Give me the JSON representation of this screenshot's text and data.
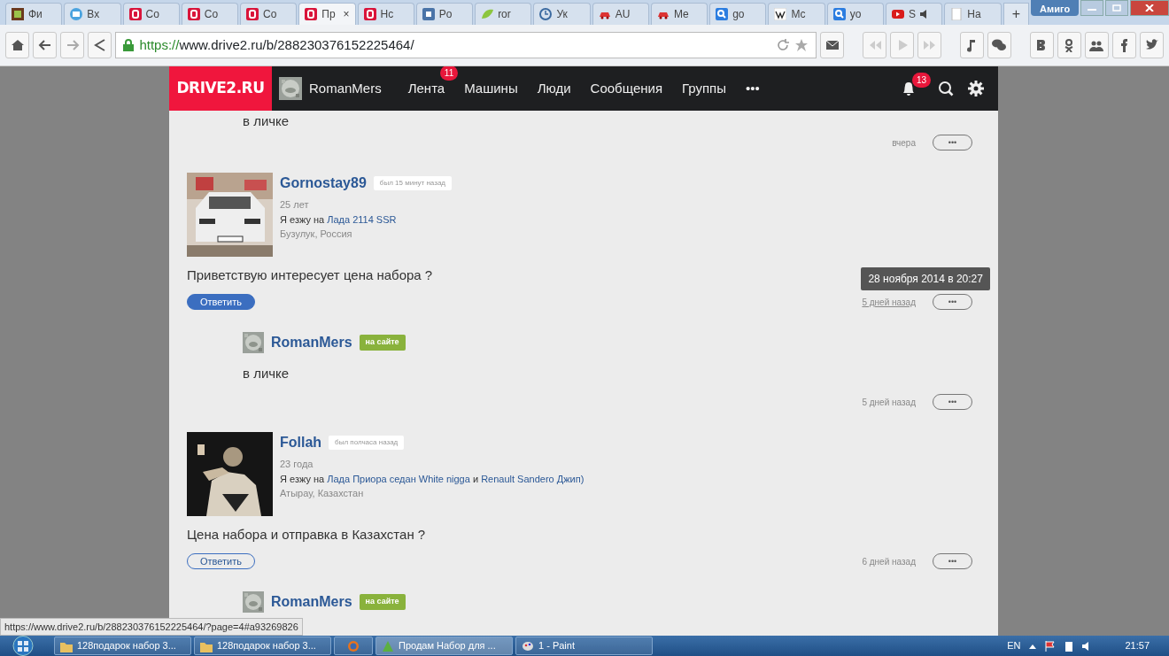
{
  "browser": {
    "tabs": [
      {
        "label": "Фи",
        "kind": "tile",
        "selected": false
      },
      {
        "label": "Вх",
        "kind": "mail",
        "selected": false
      },
      {
        "label": "Co",
        "kind": "drive",
        "selected": false
      },
      {
        "label": "Co",
        "kind": "drive",
        "selected": false
      },
      {
        "label": "Co",
        "kind": "drive",
        "selected": false
      },
      {
        "label": "Пр",
        "kind": "drive",
        "selected": true,
        "close": "×"
      },
      {
        "label": "Нс",
        "kind": "drive",
        "selected": false
      },
      {
        "label": "Po",
        "kind": "vk",
        "selected": false
      },
      {
        "label": "ror",
        "kind": "leaf",
        "selected": false
      },
      {
        "label": "Ук",
        "kind": "clock",
        "selected": false
      },
      {
        "label": "AU",
        "kind": "car",
        "selected": false
      },
      {
        "label": "Me",
        "kind": "car",
        "selected": false
      },
      {
        "label": "go",
        "kind": "search",
        "selected": false
      },
      {
        "label": "Mc",
        "kind": "wiki",
        "selected": false
      },
      {
        "label": "yo",
        "kind": "search",
        "selected": false
      },
      {
        "label": "S",
        "kind": "youtube",
        "selected": false,
        "muted": true
      },
      {
        "label": "На",
        "kind": "page",
        "selected": false
      }
    ],
    "new_tab": "+",
    "profile": "Амиго",
    "url_scheme": "https://",
    "url_rest": "www.drive2.ru/b/288230376152225464/",
    "status_url": "https://www.drive2.ru/b/288230376152225464/?page=4#a93269826"
  },
  "site": {
    "logo": "DRIVE2.RU",
    "user": "RomanMers",
    "nav": [
      {
        "label": "Лента",
        "badge": "11"
      },
      {
        "label": "Машины"
      },
      {
        "label": "Люди"
      },
      {
        "label": "Сообщения"
      },
      {
        "label": "Группы"
      },
      {
        "label": "•••"
      }
    ],
    "notifications": "13"
  },
  "comments": [
    {
      "kind": "tail",
      "text": "в личке",
      "time": "вчера",
      "more": "•••"
    },
    {
      "kind": "comment",
      "author": "Gornostay89",
      "status": {
        "text": "был 15 минут назад",
        "online": false
      },
      "age": "25 лет",
      "car": [
        {
          "kind": "text",
          "text": "Я езжу на"
        },
        {
          "kind": "link",
          "text": "Лада 2114 SSR"
        }
      ],
      "location": "Бузулук, Россия",
      "text": "Приветствую интересует цена набора ?",
      "reply": {
        "label": "Ответить",
        "selected": true
      },
      "time": "5 дней назад",
      "tooltip": "28 ноября 2014 в 20:27",
      "more": "•••"
    },
    {
      "kind": "reply",
      "author": "RomanMers",
      "status": {
        "text": "на сайте",
        "online": true
      },
      "text": "в личке",
      "time": "5 дней назад",
      "more": "•••"
    },
    {
      "kind": "comment",
      "author": "Follah",
      "status": {
        "text": "был полчаса назад",
        "online": false
      },
      "age": "23 года",
      "car": [
        {
          "kind": "text",
          "text": "Я езжу на"
        },
        {
          "kind": "link",
          "text": "Лада Приора седан White nigga"
        },
        {
          "kind": "text",
          "text": "и"
        },
        {
          "kind": "link",
          "text": "Renault Sandero"
        },
        {
          "kind": "link",
          "text": "Джип)"
        }
      ],
      "location": "Атырау, Казахстан",
      "text": "Цена набора и отправка в Казахстан ?",
      "reply": {
        "label": "Ответить",
        "selected": false
      },
      "time": "6 дней назад",
      "more": "•••"
    },
    {
      "kind": "reply_head",
      "author": "RomanMers",
      "status": {
        "text": "на сайте",
        "online": true
      }
    }
  ],
  "taskbar": {
    "items": [
      {
        "label": "128подарок набор 3...",
        "kind": "folder",
        "selected": false
      },
      {
        "label": "128подарок набор 3...",
        "kind": "folder",
        "selected": false
      },
      {
        "kind": "firefox",
        "selected": false
      },
      {
        "label": "Продам Набор для ...",
        "kind": "browser",
        "selected": true
      },
      {
        "label": "1 - Paint",
        "kind": "paint",
        "selected": false
      }
    ],
    "lang": "EN",
    "clock": "21:57"
  }
}
